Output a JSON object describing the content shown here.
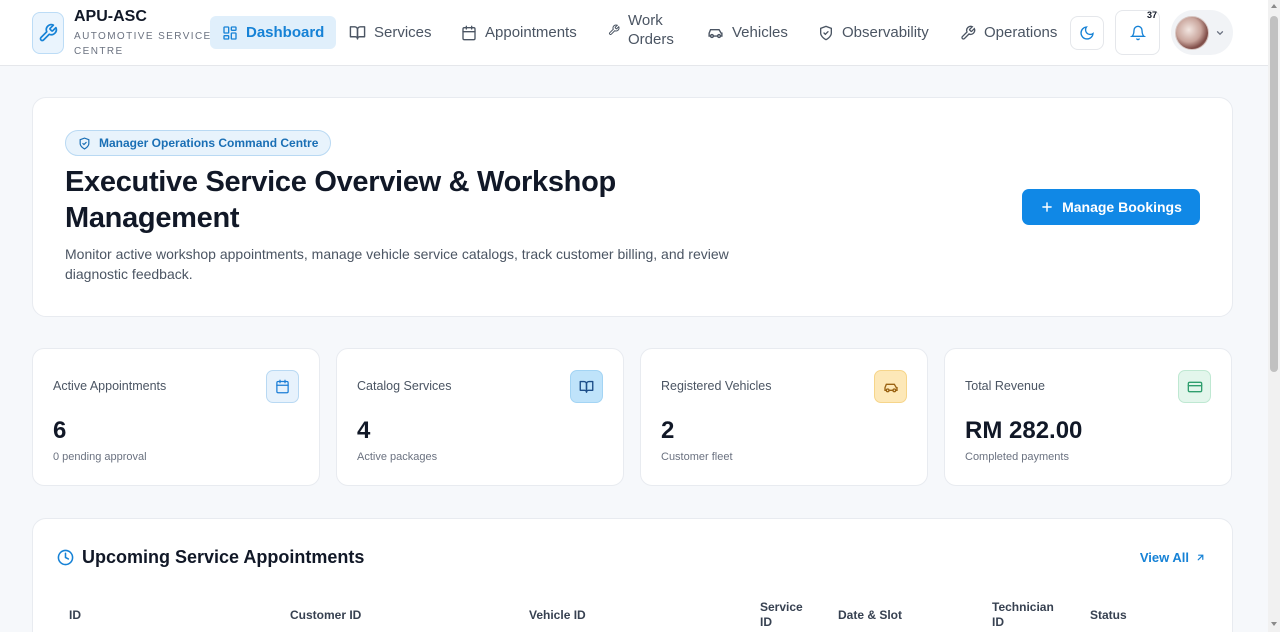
{
  "brand": {
    "name": "APU-ASC",
    "subtitle": "AUTOMOTIVE SERVICE CENTRE"
  },
  "nav": {
    "dashboard": "Dashboard",
    "services": "Services",
    "appointments": "Appointments",
    "work_orders": "Work Orders",
    "vehicles": "Vehicles",
    "observability": "Observability",
    "operations": "Operations"
  },
  "notifications": {
    "count": "37"
  },
  "hero": {
    "pill": "Manager Operations Command Centre",
    "title": "Executive Service Overview & Workshop Management",
    "description": "Monitor active workshop appointments, manage vehicle service catalogs, track customer billing, and review diagnostic feedback.",
    "button": "Manage Bookings"
  },
  "stats": [
    {
      "label": "Active Appointments",
      "value": "6",
      "sub": "0 pending approval",
      "icon": "calendar-icon",
      "color": "#1c7ed6"
    },
    {
      "label": "Catalog Services",
      "value": "4",
      "sub": "Active packages",
      "icon": "book-icon",
      "color": "#1d4e89"
    },
    {
      "label": "Registered Vehicles",
      "value": "2",
      "sub": "Customer fleet",
      "icon": "car-icon",
      "color": "#b7791f"
    },
    {
      "label": "Total Revenue",
      "value": "RM 282.00",
      "sub": "Completed payments",
      "icon": "credit-card-icon",
      "color": "#2f9e6e"
    }
  ],
  "appointments": {
    "title": "Upcoming Service Appointments",
    "view_all": "View All",
    "columns": [
      "ID",
      "Customer ID",
      "Vehicle ID",
      "Service ID",
      "Date & Slot",
      "Technician ID",
      "Status"
    ]
  }
}
